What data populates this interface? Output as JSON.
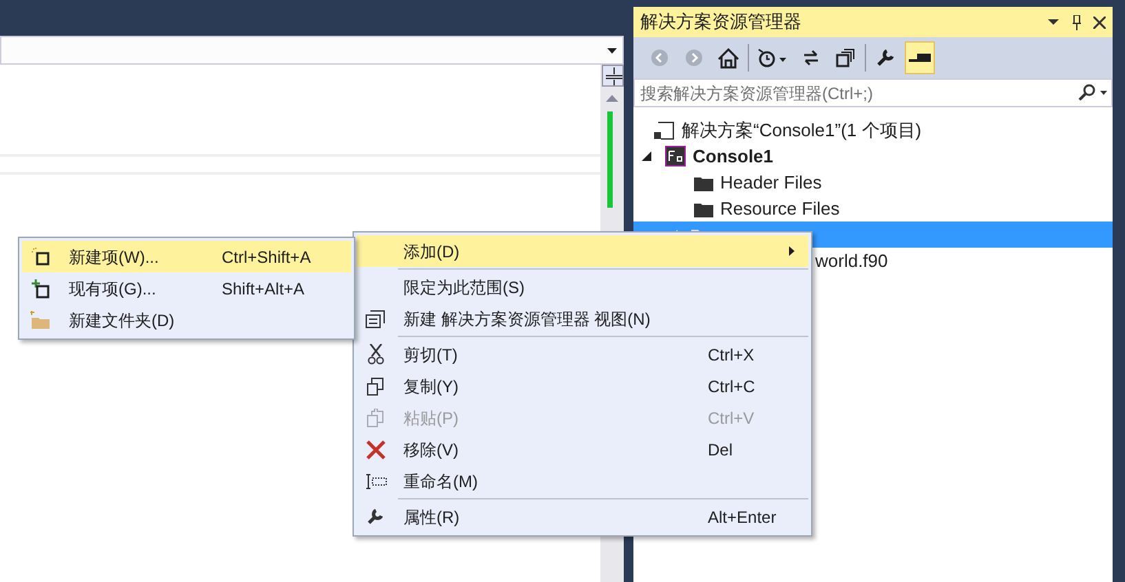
{
  "solution_explorer": {
    "title": "解决方案资源管理器",
    "toolbar": [
      {
        "kind": "back",
        "disabled": true,
        "selected": false
      },
      {
        "kind": "forward",
        "disabled": true,
        "selected": false
      },
      {
        "kind": "home",
        "disabled": false,
        "selected": false
      },
      {
        "kind": "history",
        "disabled": false,
        "selected": false
      },
      {
        "kind": "sync",
        "disabled": false,
        "selected": false
      },
      {
        "kind": "collapse",
        "disabled": false,
        "selected": false
      },
      {
        "kind": "properties",
        "disabled": false,
        "selected": false
      },
      {
        "kind": "preview",
        "disabled": false,
        "selected": true
      }
    ],
    "search": {
      "placeholder": "搜索解决方案资源管理器(Ctrl+;)"
    },
    "tree": [
      {
        "label": "解决方案“Console1”(1 个项目)",
        "kind": "solution",
        "selected": false,
        "children": [
          {
            "label": "Console1",
            "kind": "project",
            "selected": false,
            "expanded": true,
            "children": [
              {
                "label": "Header Files",
                "kind": "folder",
                "selected": false
              },
              {
                "label": "Resource Files",
                "kind": "folder",
                "selected": false
              },
              {
                "kind": "folder",
                "selected": true,
                "expanded": true,
                "children": [
                  {
                    "label": "world.f90",
                    "kind": "file",
                    "selected": false
                  }
                ]
              }
            ]
          }
        ]
      }
    ]
  },
  "context_menu": {
    "items": [
      {
        "kind": "item",
        "label": "添加(D)",
        "selected": true,
        "submenu": true,
        "disabled": false
      },
      {
        "kind": "separator"
      },
      {
        "kind": "item",
        "label": "限定为此范围(S)",
        "selected": false,
        "disabled": false
      },
      {
        "kind": "item",
        "label": "新建 解决方案资源管理器 视图(N)",
        "selected": false,
        "disabled": false
      },
      {
        "kind": "separator"
      },
      {
        "kind": "item",
        "label": "剪切(T)",
        "shortcut": "Ctrl+X",
        "selected": false,
        "disabled": false
      },
      {
        "kind": "item",
        "label": "复制(Y)",
        "shortcut": "Ctrl+C",
        "selected": false,
        "disabled": false
      },
      {
        "kind": "item",
        "label": "粘贴(P)",
        "shortcut": "Ctrl+V",
        "selected": false,
        "disabled": true
      },
      {
        "kind": "item",
        "label": "移除(V)",
        "shortcut": "Del",
        "selected": false,
        "disabled": false
      },
      {
        "kind": "item",
        "label": "重命名(M)",
        "selected": false,
        "disabled": false
      },
      {
        "kind": "separator"
      },
      {
        "kind": "item",
        "label": "属性(R)",
        "shortcut": "Alt+Enter",
        "selected": false,
        "disabled": false
      }
    ]
  },
  "submenu": {
    "items": [
      {
        "label": "新建项(W)...",
        "shortcut": "Ctrl+Shift+A",
        "selected": true
      },
      {
        "label": "现有项(G)...",
        "shortcut": "Shift+Alt+A",
        "selected": false
      },
      {
        "label": "新建文件夹(D)",
        "selected": false
      }
    ]
  }
}
